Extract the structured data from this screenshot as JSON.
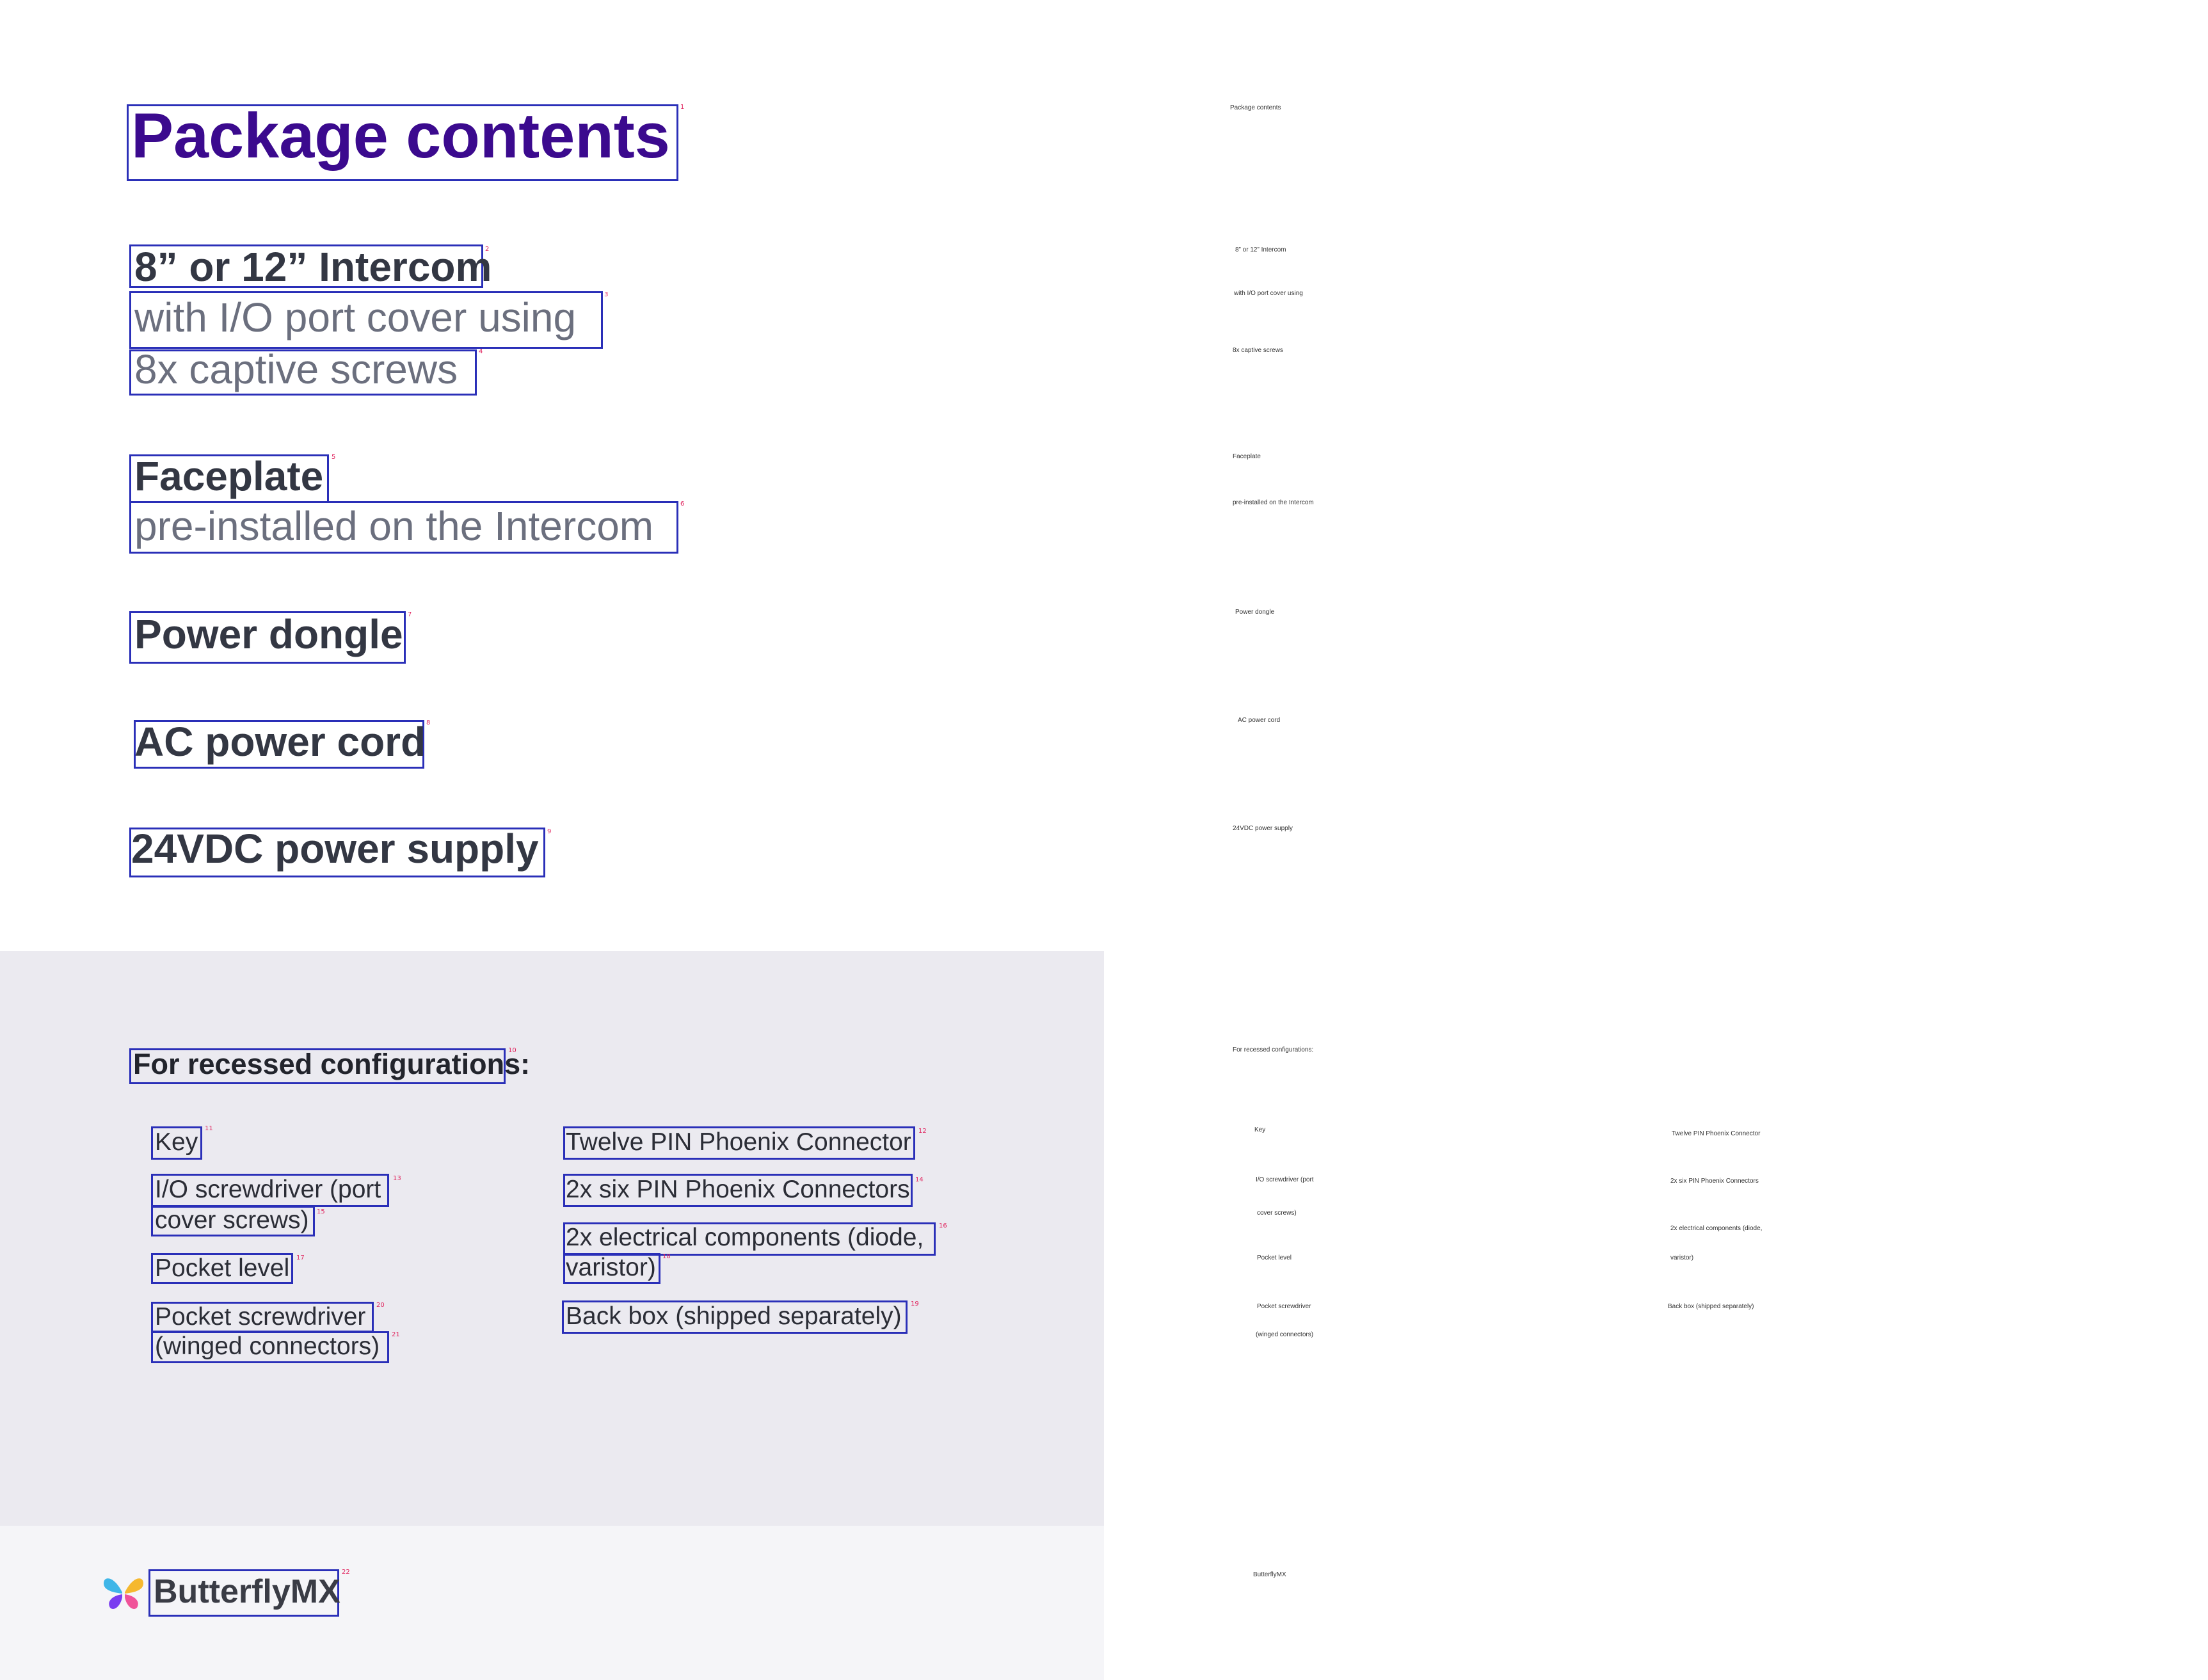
{
  "title": "Package contents",
  "items": {
    "intercom": {
      "title": "8” or 12” Intercom",
      "line1": "with I/O port cover using",
      "line2": "8x captive screws"
    },
    "faceplate": {
      "title": "Faceplate",
      "line1": "pre-installed on the Intercom"
    },
    "power_dongle": {
      "title": "Power dongle"
    },
    "ac_cord": {
      "title": "AC power cord"
    },
    "power_supply": {
      "title": "24VDC power supply"
    }
  },
  "recessed": {
    "title": "For recessed configurations:",
    "left_col": {
      "key": "Key",
      "io_driver_1": "I/O screwdriver (port",
      "io_driver_2": "cover screws)",
      "pocket_level": "Pocket level",
      "pocket_driver_1": "Pocket screwdriver",
      "pocket_driver_2": "(winged connectors)"
    },
    "right_col": {
      "twelve_pin": "Twelve PIN Phoenix Connector",
      "six_pin": "2x six PIN Phoenix Connectors",
      "electrical_1": "2x electrical components (diode,",
      "electrical_2": "varistor)",
      "back_box": "Back box (shipped separately)"
    }
  },
  "brand": "ButterflyMX",
  "annotation_numbers": [
    "1",
    "2",
    "3",
    "4",
    "5",
    "6",
    "7",
    "8",
    "9",
    "10",
    "11",
    "12",
    "13",
    "14",
    "15",
    "16",
    "17",
    "18",
    "19",
    "20",
    "21",
    "22"
  ],
  "mini": {
    "title": "Package contents",
    "intercom": "8” or 12” Intercom",
    "intercom_1": "with I/O port cover using",
    "intercom_2": "8x captive screws",
    "faceplate": "Faceplate",
    "faceplate_1": "pre-installed on the Intercom",
    "power_dongle": "Power dongle",
    "ac_cord": "AC power cord",
    "power_supply": "24VDC power supply",
    "recessed": "For recessed configurations:",
    "key": "Key",
    "io_1": "I/O screwdriver (port",
    "io_2": "cover screws)",
    "pocket_level": "Pocket level",
    "pocket_driver_1": "Pocket screwdriver",
    "pocket_driver_2": "(winged connectors)",
    "twelve_pin": "Twelve PIN Phoenix Connector",
    "six_pin": "2x six PIN Phoenix Connectors",
    "electrical_1": "2x electrical components (diode,",
    "electrical_2": "varistor)",
    "back_box": "Back box (shipped separately)",
    "brand": "ButterflyMX"
  }
}
